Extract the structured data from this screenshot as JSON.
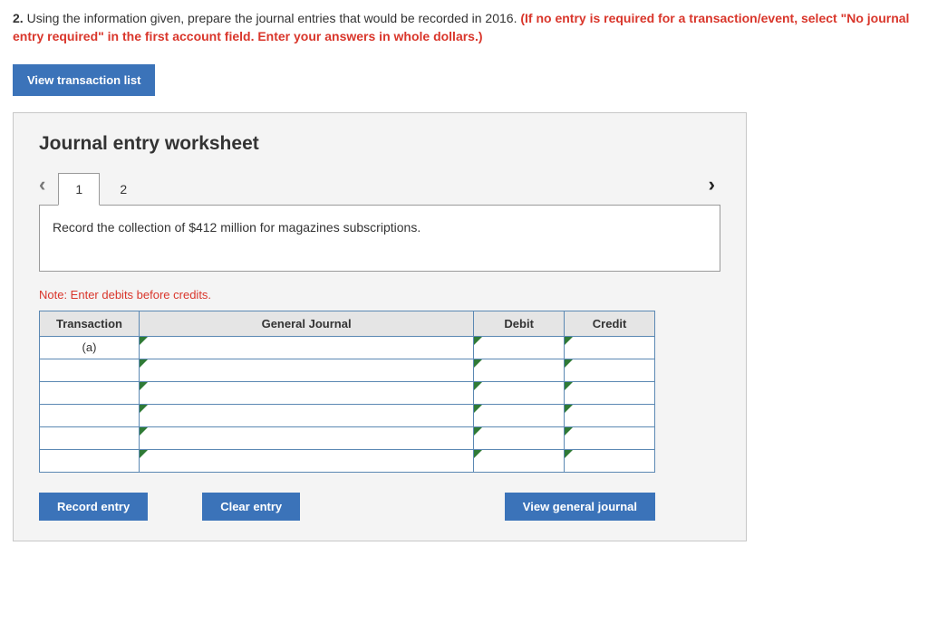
{
  "question": {
    "number": "2.",
    "text": "Using the information given, prepare the journal entries that would be recorded in 2016.",
    "hint": "(If no entry is required for a transaction/event, select \"No journal entry required\" in the first account field. Enter your answers in whole dollars.)"
  },
  "buttons": {
    "view_list": "View transaction list",
    "record": "Record entry",
    "clear": "Clear entry",
    "view_journal": "View general journal"
  },
  "worksheet": {
    "title": "Journal entry worksheet",
    "tabs": [
      "1",
      "2"
    ],
    "active_tab": "1",
    "description": "Record the collection of $412 million for magazines subscriptions.",
    "note": "Note: Enter debits before credits.",
    "columns": {
      "transaction": "Transaction",
      "general": "General Journal",
      "debit": "Debit",
      "credit": "Credit"
    },
    "rows": [
      {
        "transaction": "(a)",
        "general": "",
        "debit": "",
        "credit": ""
      },
      {
        "transaction": "",
        "general": "",
        "debit": "",
        "credit": ""
      },
      {
        "transaction": "",
        "general": "",
        "debit": "",
        "credit": ""
      },
      {
        "transaction": "",
        "general": "",
        "debit": "",
        "credit": ""
      },
      {
        "transaction": "",
        "general": "",
        "debit": "",
        "credit": ""
      },
      {
        "transaction": "",
        "general": "",
        "debit": "",
        "credit": ""
      }
    ]
  }
}
